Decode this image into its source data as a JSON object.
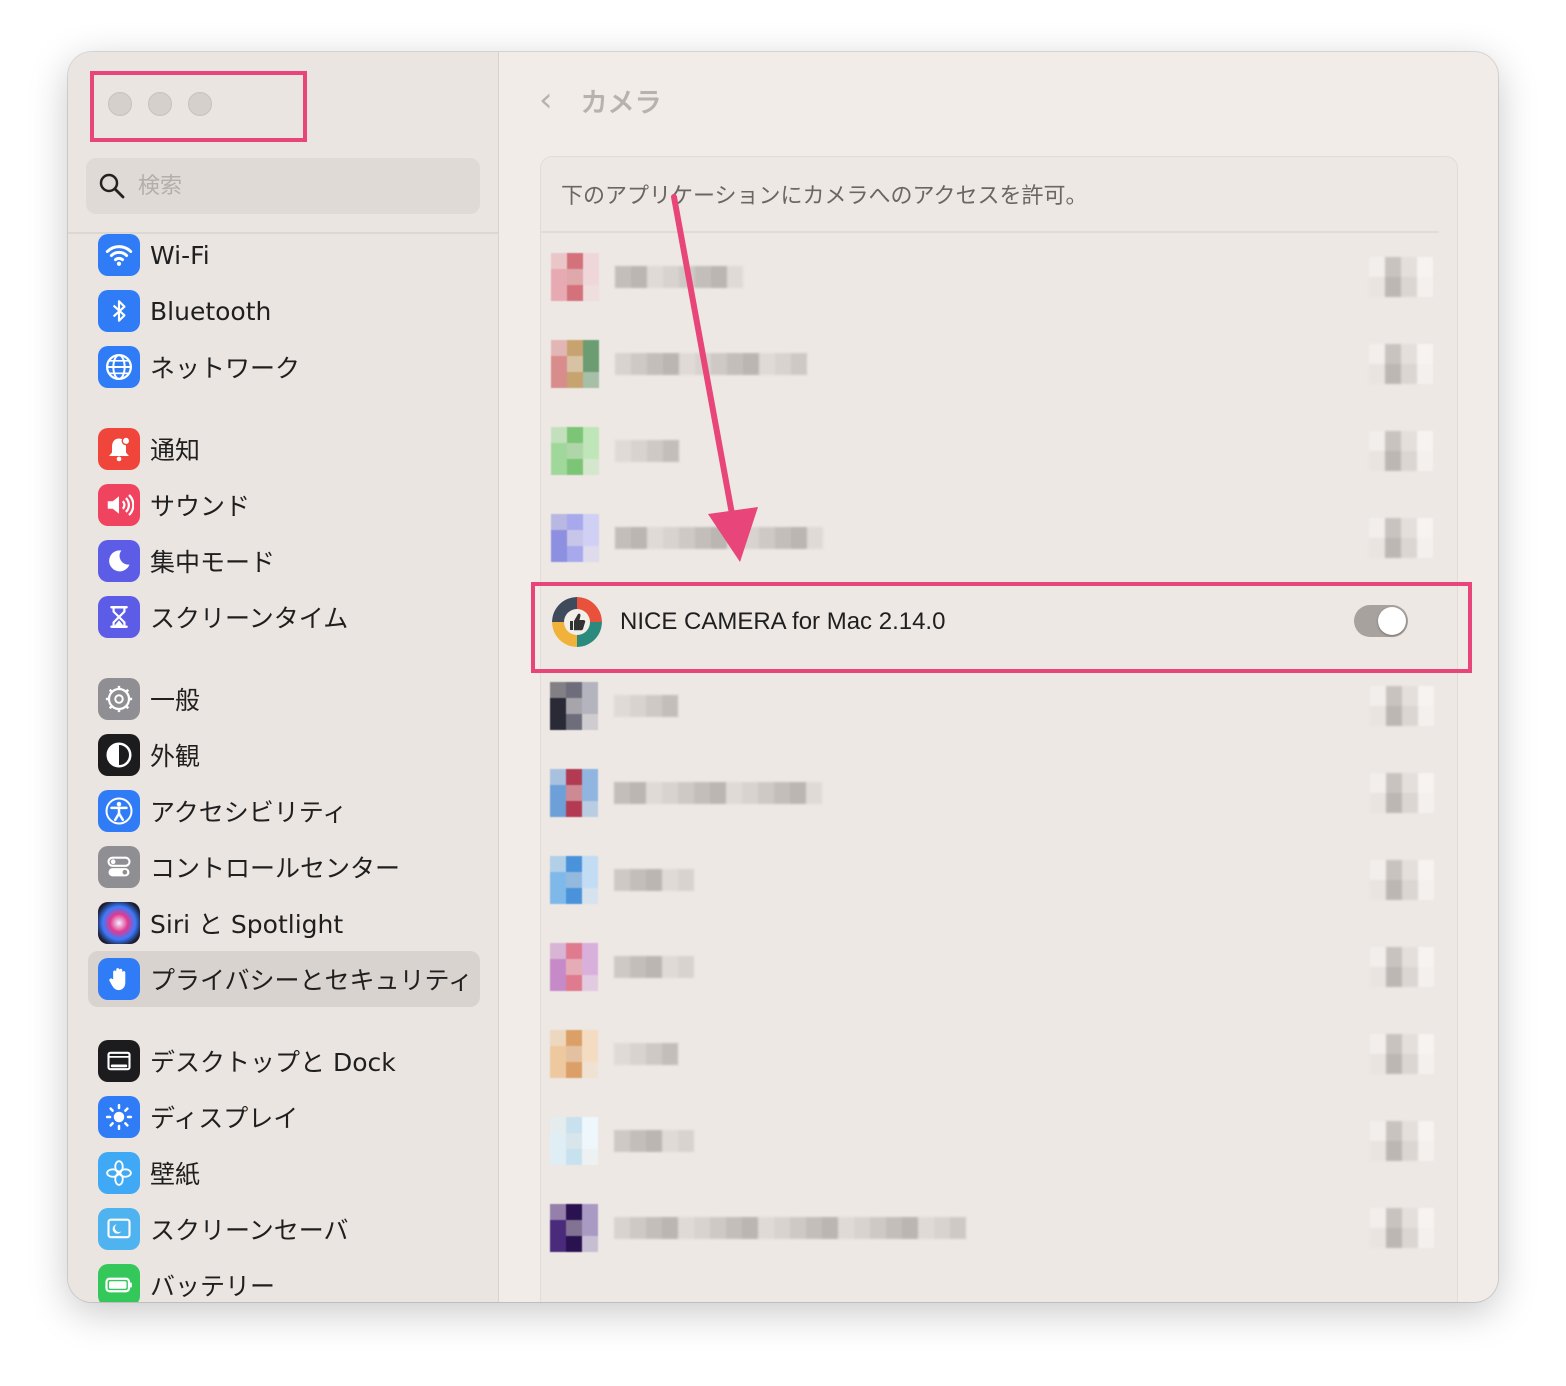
{
  "sidebar": {
    "search_placeholder": "検索",
    "items": [
      {
        "label": "Wi-Fi",
        "icon": "wifi-icon",
        "color": "#2f7cf6"
      },
      {
        "label": "Bluetooth",
        "icon": "bluetooth-icon",
        "color": "#2f7cf6"
      },
      {
        "label": "ネットワーク",
        "icon": "globe-icon",
        "color": "#2f7cf6"
      },
      {
        "label": "通知",
        "icon": "bell-icon",
        "color": "#f0453a"
      },
      {
        "label": "サウンド",
        "icon": "speaker-icon",
        "color": "#f0435f"
      },
      {
        "label": "集中モード",
        "icon": "moon-icon",
        "color": "#5d5ce6"
      },
      {
        "label": "スクリーンタイム",
        "icon": "hourglass-icon",
        "color": "#5d5ce6"
      },
      {
        "label": "一般",
        "icon": "gear-icon",
        "color": "#8e8e93"
      },
      {
        "label": "外観",
        "icon": "appearance-icon",
        "color": "#1c1c1e"
      },
      {
        "label": "アクセシビリティ",
        "icon": "accessibility-icon",
        "color": "#2f7cf6"
      },
      {
        "label": "コントロールセンター",
        "icon": "control-center-icon",
        "color": "#8e8e93"
      },
      {
        "label": "Siri と Spotlight",
        "icon": "siri-icon",
        "color": "#6b3fd8"
      },
      {
        "label": "プライバシーとセキュリティ",
        "icon": "hand-icon",
        "color": "#2f7cf6"
      },
      {
        "label": "デスクトップと Dock",
        "icon": "dock-icon",
        "color": "#1c1c1e"
      },
      {
        "label": "ディスプレイ",
        "icon": "sun-icon",
        "color": "#2f7cf6"
      },
      {
        "label": "壁紙",
        "icon": "flower-icon",
        "color": "#3fa9f5"
      },
      {
        "label": "スクリーンセーバ",
        "icon": "screensaver-icon",
        "color": "#4fb3f0"
      },
      {
        "label": "バッテリー",
        "icon": "battery-icon",
        "color": "#34c759"
      }
    ],
    "selected": "プライバシーとセキュリティ"
  },
  "main": {
    "back_icon": "chevron-left-icon",
    "title": "カメラ",
    "description": "下のアプリケーションにカメラへのアクセスを許可。",
    "highlighted_app": {
      "name": "NICE CAMERA for Mac 2.14.0",
      "toggle_on": true
    }
  },
  "colors": {
    "annotation": "#e8457a",
    "window_bg": "#f1ece8",
    "sidebar_bg": "#ebe5e1"
  }
}
